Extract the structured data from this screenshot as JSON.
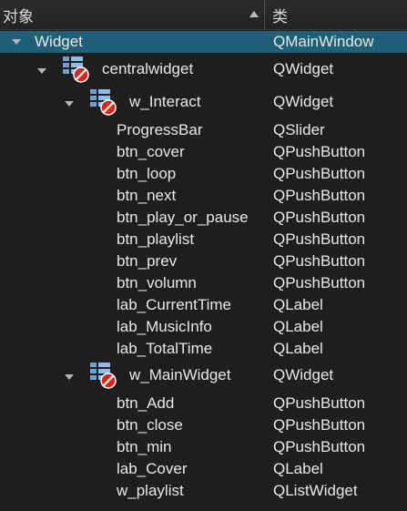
{
  "header": {
    "object_label": "对象",
    "class_label": "类"
  },
  "rows": [
    {
      "name": "Widget",
      "class": "QMainWindow"
    },
    {
      "name": "centralwidget",
      "class": "QWidget"
    },
    {
      "name": "w_Interact",
      "class": "QWidget"
    },
    {
      "name": "ProgressBar",
      "class": "QSlider"
    },
    {
      "name": "btn_cover",
      "class": "QPushButton"
    },
    {
      "name": "btn_loop",
      "class": "QPushButton"
    },
    {
      "name": "btn_next",
      "class": "QPushButton"
    },
    {
      "name": "btn_play_or_pause",
      "class": "QPushButton"
    },
    {
      "name": "btn_playlist",
      "class": "QPushButton"
    },
    {
      "name": "btn_prev",
      "class": "QPushButton"
    },
    {
      "name": "btn_volumn",
      "class": "QPushButton"
    },
    {
      "name": "lab_CurrentTime",
      "class": "QLabel"
    },
    {
      "name": "lab_MusicInfo",
      "class": "QLabel"
    },
    {
      "name": "lab_TotalTime",
      "class": "QLabel"
    },
    {
      "name": "w_MainWidget",
      "class": "QWidget"
    },
    {
      "name": "btn_Add",
      "class": "QPushButton"
    },
    {
      "name": "btn_close",
      "class": "QPushButton"
    },
    {
      "name": "btn_min",
      "class": "QPushButton"
    },
    {
      "name": "lab_Cover",
      "class": "QLabel"
    },
    {
      "name": "w_playlist",
      "class": "QListWidget"
    }
  ],
  "colors": {
    "background": "#1e1e1e",
    "selection": "#1f5f78",
    "text": "#e8e8e8"
  }
}
